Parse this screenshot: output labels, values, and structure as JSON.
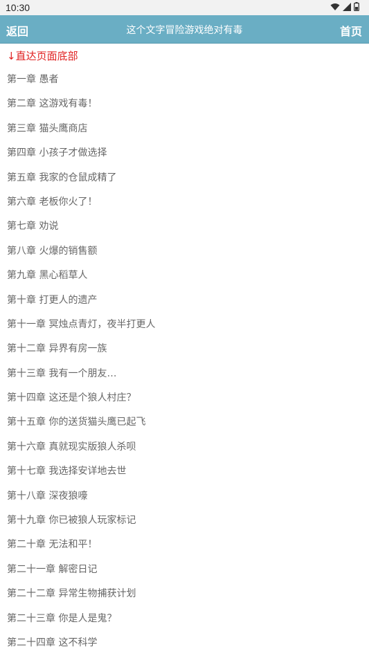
{
  "status_bar": {
    "time": "10:30",
    "icons": [
      "wifi-icon",
      "signal-icon",
      "battery-icon"
    ]
  },
  "header": {
    "back_label": "返回",
    "title": "这个文字冒险游戏绝对有毒",
    "home_label": "首页",
    "bg_color": "#6aaec4"
  },
  "jump_link": {
    "label": "↓直达页面底部",
    "color": "#e02020"
  },
  "chapters": [
    "第一章 愚者",
    "第二章 这游戏有毒！",
    "第三章 猫头鹰商店",
    "第四章 小孩子才做选择",
    "第五章 我家的仓鼠成精了",
    "第六章 老板你火了！",
    "第七章 劝说",
    "第八章 火爆的销售额",
    "第九章 黑心稻草人",
    "第十章 打更人的遗产",
    "第十一章 冥烛点青灯，夜半打更人",
    "第十二章 异界有房一族",
    "第十三章 我有一个朋友…",
    "第十四章 这还是个狼人村庄？",
    "第十五章 你的送货猫头鹰已起飞",
    "第十六章 真就现实版狼人杀呗",
    "第十七章 我选择安详地去世",
    "第十八章 深夜狼嚎",
    "第十九章 你已被狼人玩家标记",
    "第二十章 无法和平！",
    "第二十一章 解密日记",
    "第二十二章 异常生物捕获计划",
    "第二十三章 你是人是鬼？",
    "第二十四章 这不科学"
  ]
}
